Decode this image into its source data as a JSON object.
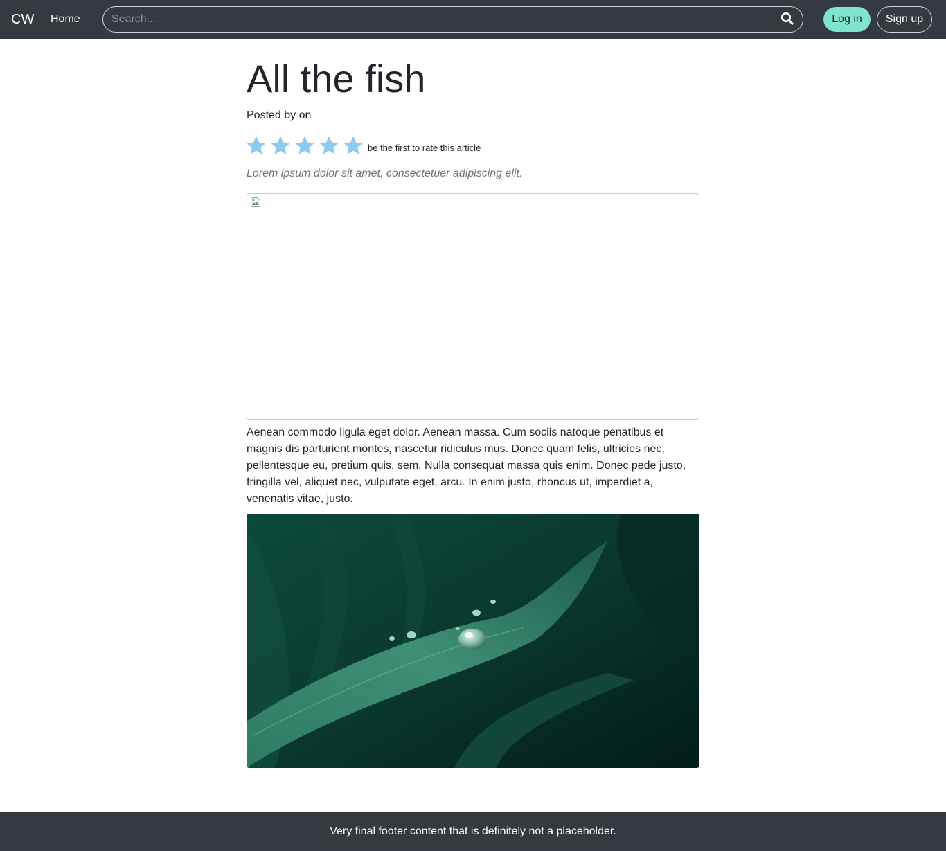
{
  "colors": {
    "navbar_bg": "#343a40",
    "accent_login_bg": "#7fe5cc",
    "star": "#8ccbed",
    "lead_text": "#6c757d",
    "footer_bg": "#343a40"
  },
  "navbar": {
    "brand": "CW",
    "links": [
      {
        "label": "Home"
      }
    ],
    "search": {
      "placeholder": "Search...",
      "value": "",
      "icon": "search-icon"
    },
    "login_label": "Log in",
    "signup_label": "Sign up"
  },
  "article": {
    "title": "All the fish",
    "posted_by": "Posted by on",
    "rating": {
      "stars": 5,
      "filled": 0,
      "text": "be the first to rate this article",
      "icon": "star-icon"
    },
    "lead": "Lorem ipsum dolor sit amet, consectetuer adipiscing elit.",
    "body": "Aenean commodo ligula eget dolor. Aenean massa. Cum sociis natoque penatibus et magnis dis parturient montes, nascetur ridiculus mus. Donec quam felis, ultricies nec, pellentesque eu, pretium quis, sem. Nulla consequat massa quis enim. Donec pede justo, fringilla vel, aliquet nec, vulputate eget, arcu. In enim justo, rhoncus ut, imperdiet a, venenatis vitae, justo."
  },
  "footer": {
    "text": "Very final footer content that is definitely not a placeholder."
  }
}
